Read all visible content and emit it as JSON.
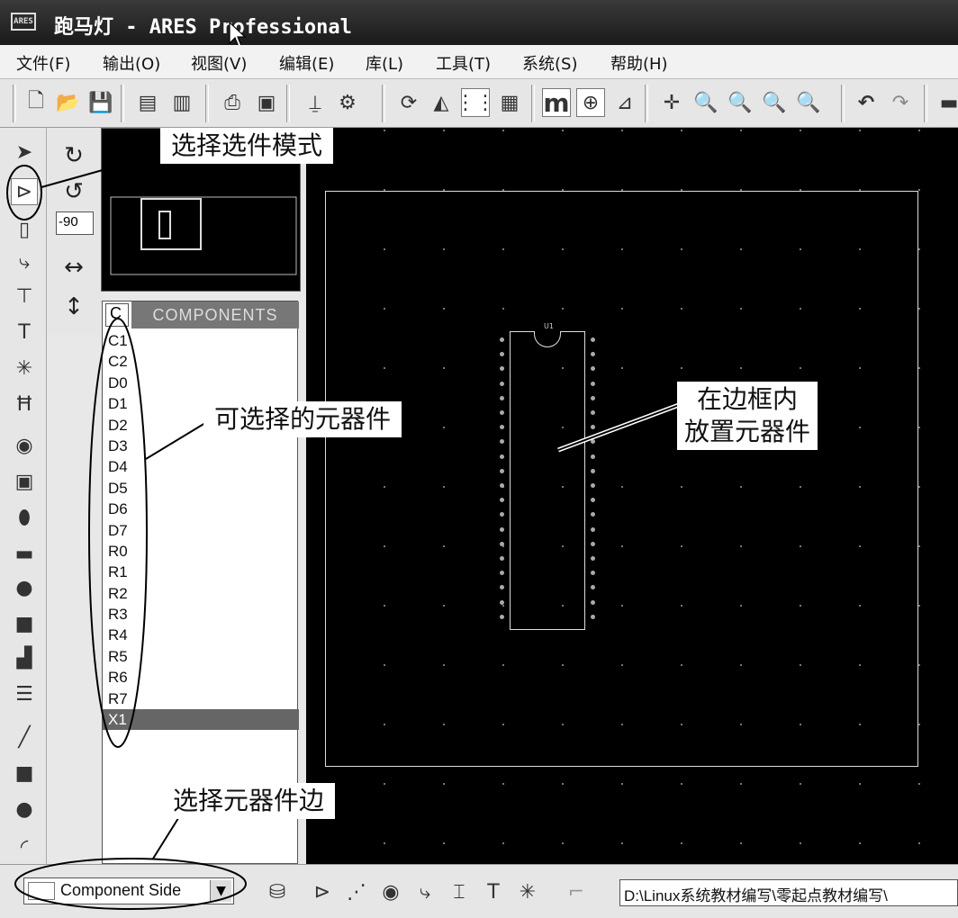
{
  "window": {
    "title": "跑马灯 - ARES Professional",
    "app_icon_text": "ARES"
  },
  "menu": [
    "文件(F)",
    "输出(O)",
    "视图(V)",
    "编辑(E)",
    "库(L)",
    "工具(T)",
    "系统(S)",
    "帮助(H)"
  ],
  "rotation": {
    "angle": "-90"
  },
  "components": {
    "tab_label": "C",
    "header": "COMPONENTS",
    "items": [
      "C1",
      "C2",
      "D0",
      "D1",
      "D2",
      "D3",
      "D4",
      "D5",
      "D6",
      "D7",
      "R0",
      "R1",
      "R2",
      "R3",
      "R4",
      "R5",
      "R6",
      "R7",
      "X1"
    ],
    "selected": "X1"
  },
  "canvas": {
    "chip_label": "U1"
  },
  "status": {
    "layer": "Component Side",
    "path": "D:\\Linux系统教材编写\\零起点教材编写\\"
  },
  "annotations": {
    "select_mode": "选择选件模式",
    "selectable_components": "可选择的元器件",
    "place_in_border_1": "在边框内",
    "place_in_border_2": "放置元器件",
    "select_side": "选择元器件边"
  },
  "colors": {
    "canvas": "#000000",
    "selected_row": "#666666"
  }
}
